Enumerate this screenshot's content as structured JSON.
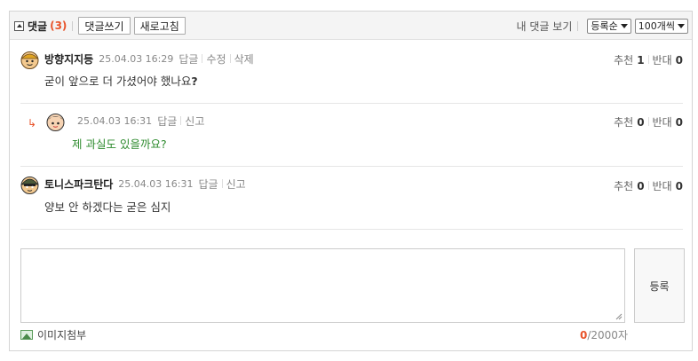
{
  "header": {
    "title": "댓글",
    "count": "(3)",
    "write_button": "댓글쓰기",
    "refresh_button": "새로고침",
    "my_comments_link": "내 댓글 보기",
    "sort_select": "등록순",
    "per_page_select": "100개씩"
  },
  "comments": [
    {
      "nickname": "방향지지등",
      "date": "25.04.03 16:29",
      "actions": [
        "답글",
        "수정",
        "삭제"
      ],
      "text": "굳이 앞으로 더 가셨어야 했나요",
      "text_suffix": "?",
      "up_label": "추천",
      "up_count": "1",
      "down_label": "반대",
      "down_count": "0"
    },
    {
      "reply_marker": "↳",
      "nickname": "",
      "date": "25.04.03 16:31",
      "actions": [
        "답글",
        "신고"
      ],
      "text": "제 과실도 있을까요?",
      "up_label": "추천",
      "up_count": "0",
      "down_label": "반대",
      "down_count": "0"
    },
    {
      "nickname": "토니스파크탄다",
      "date": "25.04.03 16:31",
      "actions": [
        "답글",
        "신고"
      ],
      "text": "양보 안 하겠다는 굳은 심지",
      "up_label": "추천",
      "up_count": "0",
      "down_label": "반대",
      "down_count": "0"
    }
  ],
  "write": {
    "textarea_value": "",
    "submit_label": "등록",
    "attach_label": "이미지첨부",
    "char_count": "0",
    "char_max": "/2000자"
  },
  "colors": {
    "accent": "#e8542b",
    "reply_text": "#2e8b2e",
    "header_bg": "#f4f4f4"
  }
}
